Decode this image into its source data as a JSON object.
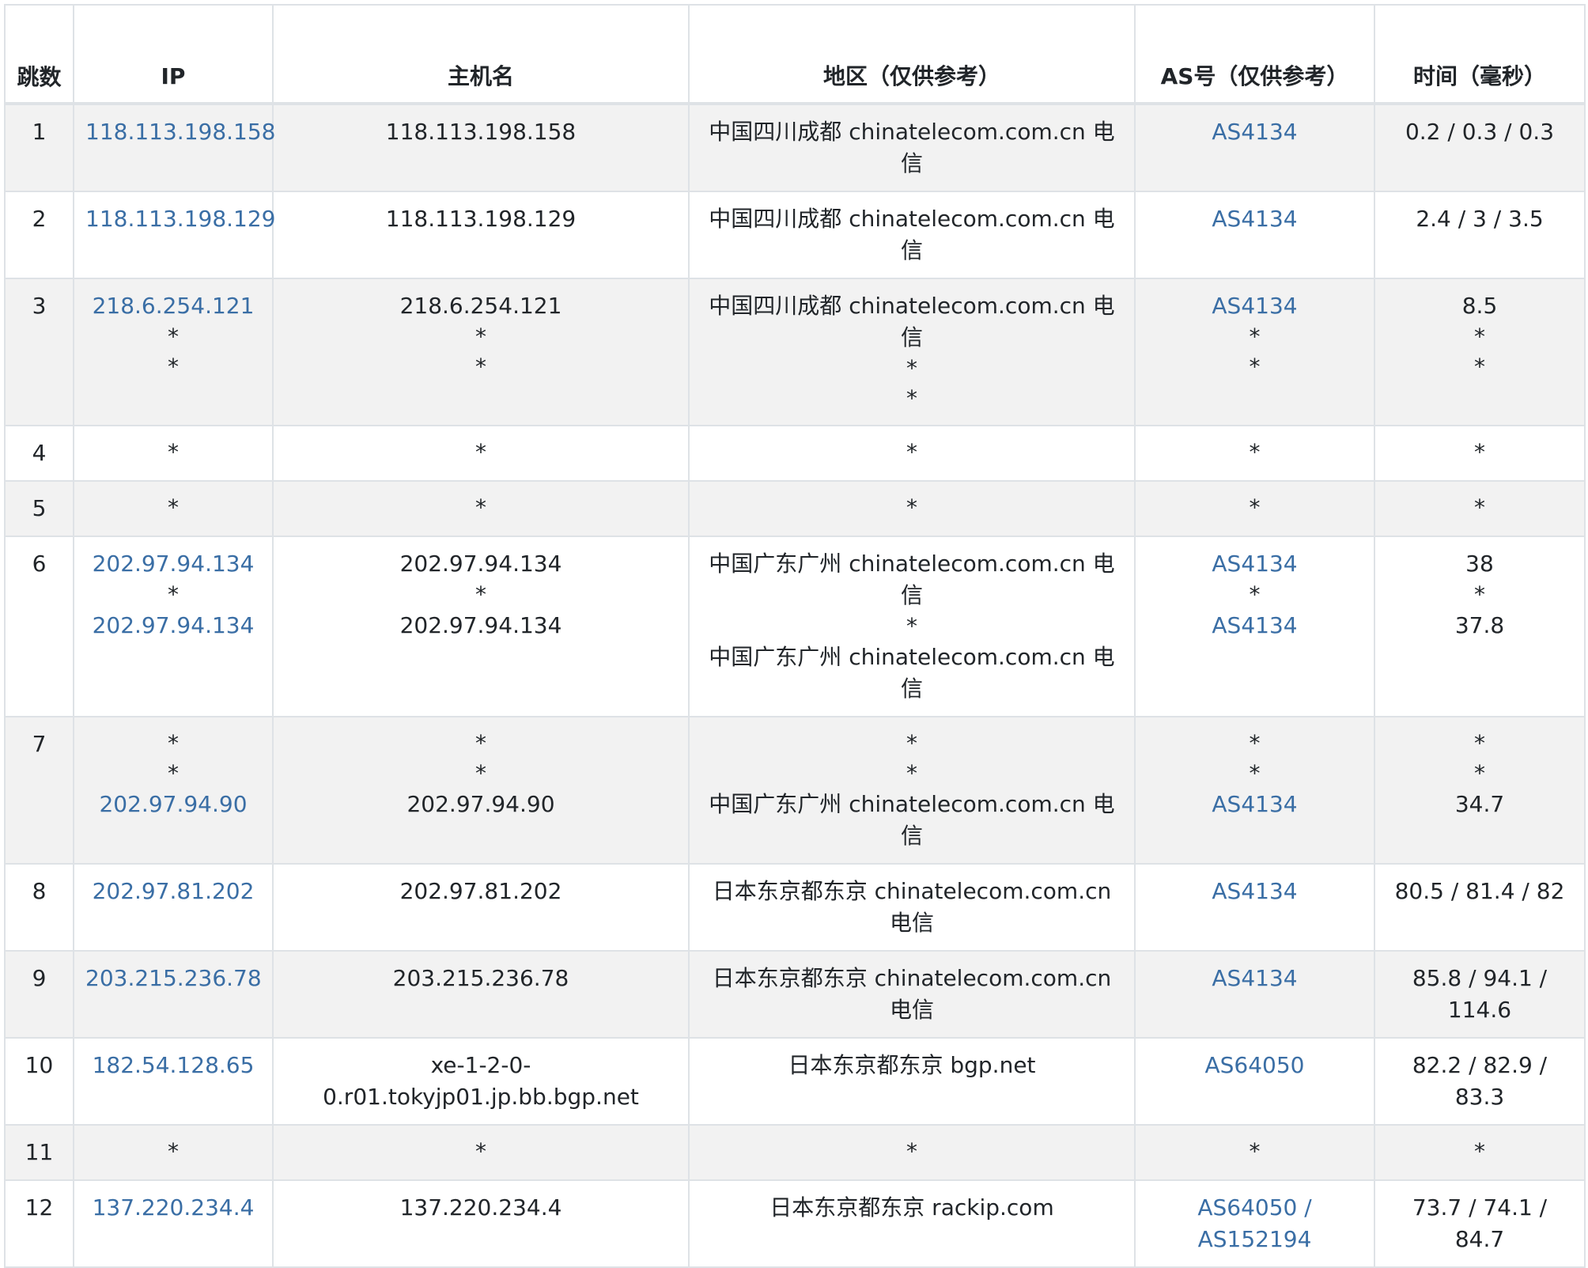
{
  "headers": {
    "hop": "跳数",
    "ip": "IP",
    "hostname": "主机名",
    "region": "地区（仅供参考）",
    "asn": "AS号（仅供参考）",
    "time": "时间（毫秒）"
  },
  "rows": [
    {
      "hop": "1",
      "ip": [
        "118.113.198.158"
      ],
      "host": [
        "118.113.198.158"
      ],
      "region": [
        "中国四川成都 chinatelecom.com.cn 电信"
      ],
      "as": [
        "AS4134"
      ],
      "time": [
        "0.2 / 0.3 / 0.3"
      ]
    },
    {
      "hop": "2",
      "ip": [
        "118.113.198.129"
      ],
      "host": [
        "118.113.198.129"
      ],
      "region": [
        "中国四川成都 chinatelecom.com.cn 电信"
      ],
      "as": [
        "AS4134"
      ],
      "time": [
        "2.4 / 3 / 3.5"
      ]
    },
    {
      "hop": "3",
      "ip": [
        "218.6.254.121",
        "*",
        "*"
      ],
      "host": [
        "218.6.254.121",
        "*",
        "*"
      ],
      "region": [
        "中国四川成都 chinatelecom.com.cn 电信",
        "*",
        "*"
      ],
      "as": [
        "AS4134",
        "*",
        "*"
      ],
      "time": [
        "8.5",
        "*",
        "*"
      ]
    },
    {
      "hop": "4",
      "ip": [
        "*"
      ],
      "host": [
        "*"
      ],
      "region": [
        "*"
      ],
      "as": [
        "*"
      ],
      "time": [
        "*"
      ]
    },
    {
      "hop": "5",
      "ip": [
        "*"
      ],
      "host": [
        "*"
      ],
      "region": [
        "*"
      ],
      "as": [
        "*"
      ],
      "time": [
        "*"
      ]
    },
    {
      "hop": "6",
      "ip": [
        "202.97.94.134",
        "*",
        "202.97.94.134"
      ],
      "host": [
        "202.97.94.134",
        "*",
        "202.97.94.134"
      ],
      "region": [
        "中国广东广州 chinatelecom.com.cn 电信",
        "*",
        "中国广东广州 chinatelecom.com.cn 电信"
      ],
      "as": [
        "AS4134",
        "*",
        "AS4134"
      ],
      "time": [
        "38",
        "*",
        "37.8"
      ]
    },
    {
      "hop": "7",
      "ip": [
        "*",
        "*",
        "202.97.94.90"
      ],
      "host": [
        "*",
        "*",
        "202.97.94.90"
      ],
      "region": [
        "*",
        "*",
        "中国广东广州 chinatelecom.com.cn 电信"
      ],
      "as": [
        "*",
        "*",
        "AS4134"
      ],
      "time": [
        "*",
        "*",
        "34.7"
      ]
    },
    {
      "hop": "8",
      "ip": [
        "202.97.81.202"
      ],
      "host": [
        "202.97.81.202"
      ],
      "region": [
        "日本东京都东京 chinatelecom.com.cn 电信"
      ],
      "as": [
        "AS4134"
      ],
      "time": [
        "80.5 / 81.4 / 82"
      ]
    },
    {
      "hop": "9",
      "ip": [
        "203.215.236.78"
      ],
      "host": [
        "203.215.236.78"
      ],
      "region": [
        "日本东京都东京 chinatelecom.com.cn 电信"
      ],
      "as": [
        "AS4134"
      ],
      "time": [
        "85.8 / 94.1 / 114.6"
      ]
    },
    {
      "hop": "10",
      "ip": [
        "182.54.128.65"
      ],
      "host": [
        "xe-1-2-0-0.r01.tokyjp01.jp.bb.bgp.net"
      ],
      "region": [
        "日本东京都东京 bgp.net"
      ],
      "as": [
        "AS64050"
      ],
      "time": [
        "82.2 / 82.9 / 83.3"
      ]
    },
    {
      "hop": "11",
      "ip": [
        "*"
      ],
      "host": [
        "*"
      ],
      "region": [
        "*"
      ],
      "as": [
        "*"
      ],
      "time": [
        "*"
      ]
    },
    {
      "hop": "12",
      "ip": [
        "137.220.234.4"
      ],
      "host": [
        "137.220.234.4"
      ],
      "region": [
        "日本东京都东京 rackip.com"
      ],
      "as": [
        "AS64050 / AS152194"
      ],
      "time": [
        "73.7 / 74.1 / 84.7"
      ]
    }
  ]
}
